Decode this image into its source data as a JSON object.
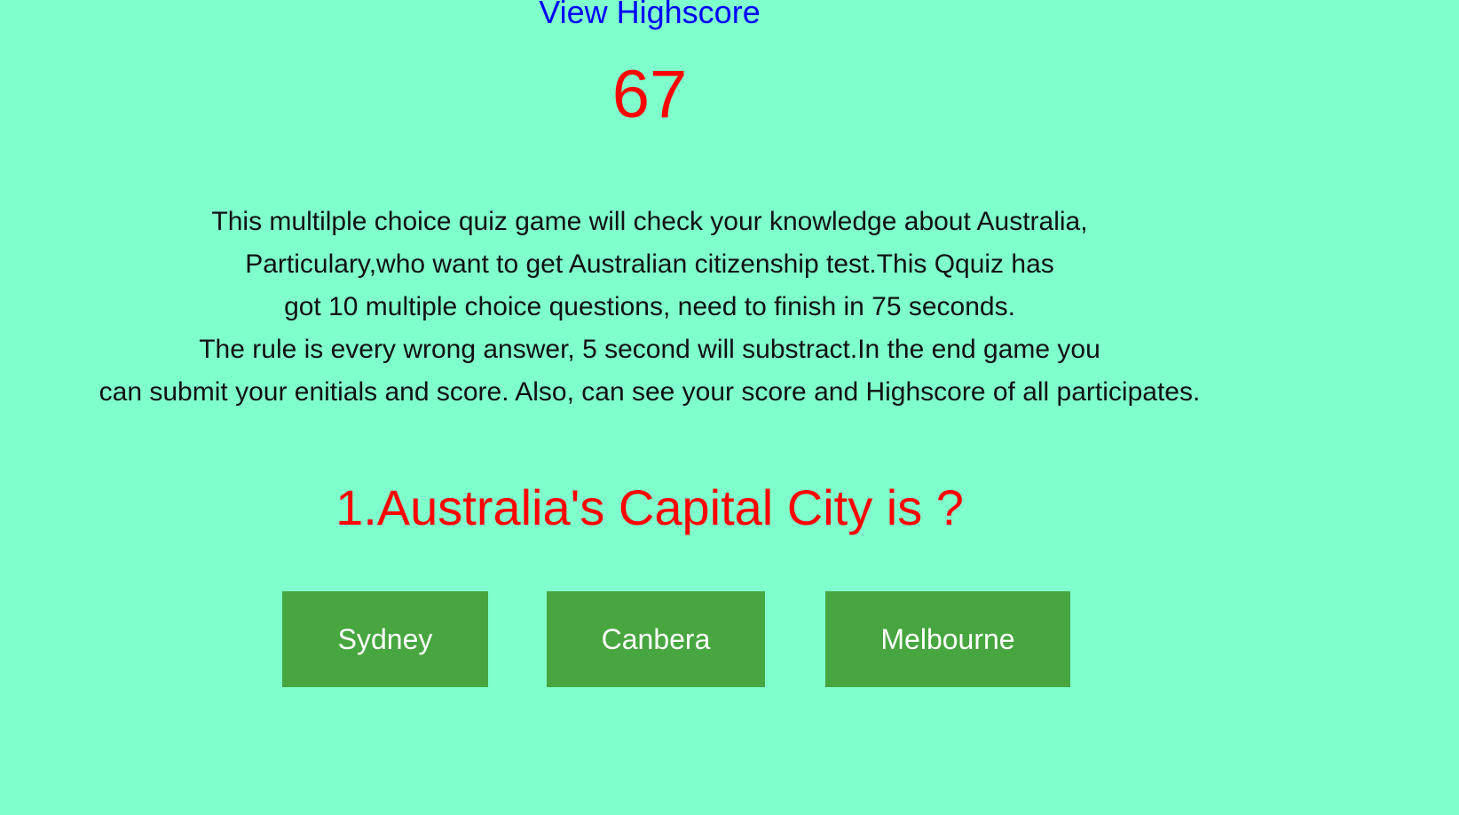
{
  "header": {
    "highscore_link": "View Highscore"
  },
  "timer": {
    "seconds_left": "67"
  },
  "intro": {
    "lines": [
      "This multilple choice quiz game will check your knowledge about Australia,",
      "Particulary,who want to get Australian citizenship test.This Qquiz has",
      "got 10 multiple choice questions, need to finish in 75 seconds.",
      "The rule is every wrong answer, 5 second will substract.In the end game you",
      "can submit your enitials and score. Also, can see your score and Highscore of all participates."
    ]
  },
  "quiz": {
    "question": "1.Australia's Capital City is ?",
    "choices": [
      "Sydney",
      "Canbera",
      "Melbourne"
    ]
  },
  "colors": {
    "background": "#7fffcc",
    "link": "#0000ff",
    "accent_red": "#ff0000",
    "button_green": "#47a63f"
  }
}
